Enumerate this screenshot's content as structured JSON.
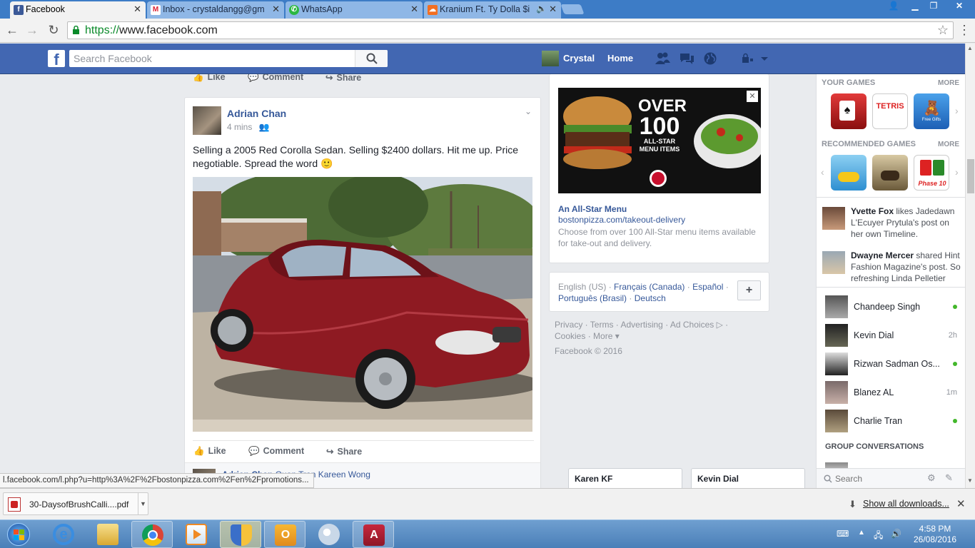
{
  "tabs": [
    {
      "title": "Facebook",
      "icon": "facebook-icon",
      "active": true
    },
    {
      "title": "Inbox - crystaldangg@gm",
      "icon": "gmail-icon"
    },
    {
      "title": "WhatsApp",
      "icon": "whatsapp-icon"
    },
    {
      "title": "Kranium Ft. Ty Dolla $i",
      "icon": "soundcloud-icon"
    }
  ],
  "address": {
    "scheme": "https://",
    "host": "www.facebook.com"
  },
  "fbbar": {
    "search_placeholder": "Search Facebook",
    "user_name": "Crystal",
    "home": "Home"
  },
  "post_actions": {
    "like": "Like",
    "comment": "Comment",
    "share": "Share"
  },
  "post": {
    "author": "Adrian Chan",
    "time": "4 mins",
    "text": "Selling a 2005 Red Corolla Sedan. Selling $2400 dollars. Hit me up. Price negotiable. Spread the word 🙂"
  },
  "next_post": {
    "author": "Adrian Chan",
    "rest": "Quan Tran Kareen Wong"
  },
  "ad": {
    "image_big": "OVER",
    "image_num": "100",
    "image_sub": "ALL-STAR MENU ITEMS",
    "title": "An All-Star Menu",
    "domain": "bostonpizza.com/takeout-delivery",
    "desc": "Choose from over 100 All-Star menu items available for take-out and delivery."
  },
  "languages": {
    "current": "English (US)",
    "others": [
      "Français (Canada)",
      "Español",
      "Português (Brasil)",
      "Deutsch"
    ],
    "add": "+"
  },
  "footer": {
    "privacy": "Privacy",
    "terms": "Terms",
    "advertising": "Advertising",
    "adchoices": "Ad Choices",
    "cookies": "Cookies",
    "more": "More",
    "copyright": "Facebook © 2016"
  },
  "sidebar": {
    "your_games": "YOUR GAMES",
    "more": "MORE",
    "recommended_games": "RECOMMENDED GAMES",
    "game_labels": {
      "tetris": "TETRIS",
      "free_gifts": "Free Gifts",
      "phase10": "Phase 10"
    },
    "ticker": [
      {
        "name": "Yvette Fox",
        "text": " likes Jadedawn L'Ecuyer Prytula's post on her own Timeline."
      },
      {
        "name": "Dwayne Mercer",
        "text": " shared Hint Fashion Magazine's post. So refreshing Linda Pelletier"
      }
    ],
    "contacts": [
      {
        "name": "Chandeep Singh",
        "status": "online"
      },
      {
        "name": "Kevin Dial",
        "ago": "2h"
      },
      {
        "name": "Rizwan Sadman Os...",
        "status": "online"
      },
      {
        "name": "Blanez AL",
        "ago": "1m"
      },
      {
        "name": "Charlie Tran",
        "status": "online"
      }
    ],
    "group_conversations": "GROUP CONVERSATIONS",
    "search_placeholder": "Search"
  },
  "chat_tabs": [
    "Karen KF",
    "Kevin Dial"
  ],
  "status_url": "l.facebook.com/l.php?u=http%3A%2F%2Fbostonpizza.com%2Fen%2Fpromotions...",
  "downloads": {
    "file": "30-DaysofBrushCalli....pdf",
    "show_all": "Show all downloads..."
  },
  "clock": {
    "time": "4:58 PM",
    "date": "26/08/2016"
  }
}
